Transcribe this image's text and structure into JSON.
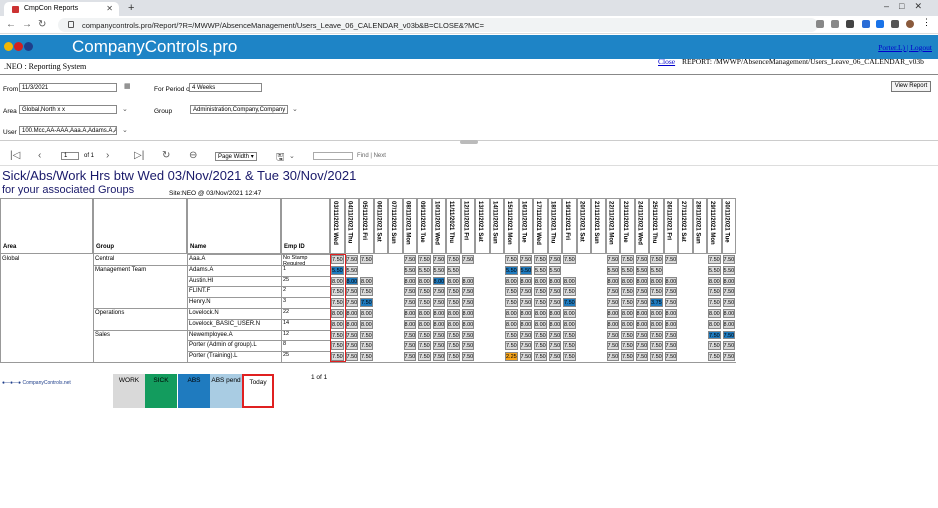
{
  "browser": {
    "tab_title": "CmpCon Reports",
    "url": "companycontrols.pro/Report/?R=/MWWP/AbsenceManagement/Users_Leave_06_CALENDAR_v03b&B=CLOSE&?MC="
  },
  "header": {
    "brand": "CompanyControls.pro",
    "subtitle": ".NEO : Reporting System",
    "user_link": "Porter.L)",
    "logout_link": "Logout",
    "close_link": "Close",
    "report_label": "REPORT: /MWWP/AbsenceManagement/Users_Leave_06_CALENDAR_v03b"
  },
  "params": {
    "from_label": "From",
    "from_value": "11/3/2021",
    "period_label": "For Period of",
    "period_value": "4 Weeks",
    "area_label": "Area",
    "area_value": "Global,North x x",
    "group_label": "Group",
    "group_value": "Administration,Company,Company >",
    "user_label": "User",
    "user_value": "100.Mcc,AA-AAA,Aaa.A,Adams.A,Au",
    "view_report": "View Report"
  },
  "toolbar": {
    "page": "1",
    "of": "of 1",
    "zoom": "Page Width",
    "find": "Find",
    "next": "Next"
  },
  "report": {
    "title": "Sick/Abs/Work Hrs btw Wed 03/Nov/2021 & Tue 30/Nov/2021",
    "subtitle": "for your associated Groups",
    "site": "Site:NEO @ 03/Nov/2021 12:47",
    "col_area": "Area",
    "col_group": "Group",
    "col_name": "Name",
    "col_empid": "Emp ID",
    "dates": [
      "03/11/2021 Wed",
      "04/11/2021 Thu",
      "05/11/2021 Fri",
      "06/11/2021 Sat",
      "07/11/2021 Sun",
      "08/11/2021 Mon",
      "09/11/2021 Tue",
      "10/11/2021 Wed",
      "11/11/2021 Thu",
      "12/11/2021 Fri",
      "13/11/2021 Sat",
      "14/11/2021 Sun",
      "15/11/2021 Mon",
      "16/11/2021 Tue",
      "17/11/2021 Wed",
      "18/11/2021 Thu",
      "19/11/2021 Fri",
      "20/11/2021 Sat",
      "21/11/2021 Sun",
      "22/11/2021 Mon",
      "23/11/2021 Tue",
      "24/11/2021 Wed",
      "25/11/2021 Thu",
      "26/11/2021 Fri",
      "27/11/2021 Sat",
      "28/11/2021 Sun",
      "29/11/2021 Mon",
      "30/11/2021 Tue"
    ],
    "areas": [
      {
        "label": "Global",
        "row": 0
      }
    ],
    "groups": [
      {
        "label": "Central",
        "row": 0
      },
      {
        "label": "Management Team",
        "row": 1
      },
      {
        "label": "Operations",
        "row": 5
      },
      {
        "label": "Sales",
        "row": 7
      }
    ],
    "rows": [
      {
        "name": "Aaa.A",
        "emp": "No Stamp Required",
        "cells": [
          "7.50",
          "7.50",
          "7.50",
          "",
          "",
          "7.50",
          "7.50",
          "7.50",
          "7.50",
          "7.50",
          "",
          "",
          "7.50",
          "7.50",
          "7.50",
          "7.50",
          "7.50",
          "",
          "",
          "7.50",
          "7.50",
          "7.50",
          "7.50",
          "7.50",
          "",
          "",
          "7.50",
          "7.50"
        ],
        "types": [
          "w",
          "w",
          "w",
          "",
          "",
          "w",
          "w",
          "w",
          "w",
          "w",
          "",
          "",
          "w",
          "w",
          "w",
          "w",
          "w",
          "",
          "",
          "w",
          "w",
          "w",
          "w",
          "w",
          "",
          "",
          "w",
          "w"
        ]
      },
      {
        "name": "Adams.A",
        "emp": "1",
        "cells": [
          "5.50",
          "5.50",
          "",
          "",
          "",
          "5.50",
          "5.50",
          "5.50",
          "5.50",
          "",
          "",
          "",
          "5.50",
          "5.50",
          "5.50",
          "5.50",
          "",
          "",
          "",
          "5.50",
          "5.50",
          "5.50",
          "5.50",
          "",
          "",
          "",
          "5.50",
          "5.50"
        ],
        "types": [
          "a",
          "w",
          "",
          "",
          "",
          "w",
          "w",
          "w",
          "w",
          "",
          "",
          "",
          "a",
          "a",
          "w",
          "w",
          "",
          "",
          "",
          "w",
          "w",
          "w",
          "w",
          "",
          "",
          "",
          "w",
          "w"
        ]
      },
      {
        "name": "Austin.HI",
        "emp": "25",
        "cells": [
          "8.00",
          "8.00",
          "8.00",
          "",
          "",
          "8.00",
          "8.00",
          "8.00",
          "8.00",
          "8.00",
          "",
          "",
          "8.00",
          "8.00",
          "8.00",
          "8.00",
          "8.00",
          "",
          "",
          "8.00",
          "8.00",
          "8.00",
          "8.00",
          "8.00",
          "",
          "",
          "8.00",
          "8.00"
        ],
        "types": [
          "w",
          "a",
          "w",
          "",
          "",
          "w",
          "w",
          "a",
          "w",
          "w",
          "",
          "",
          "w",
          "w",
          "w",
          "w",
          "w",
          "",
          "",
          "w",
          "w",
          "w",
          "w",
          "w",
          "",
          "",
          "w",
          "w"
        ]
      },
      {
        "name": "FLINT.F",
        "emp": "2",
        "cells": [
          "7.50",
          "7.50",
          "7.50",
          "",
          "",
          "7.50",
          "7.50",
          "7.50",
          "7.50",
          "7.50",
          "",
          "",
          "7.50",
          "7.50",
          "7.50",
          "7.50",
          "7.50",
          "",
          "",
          "7.50",
          "7.50",
          "7.50",
          "7.50",
          "7.50",
          "",
          "",
          "7.50",
          "7.50"
        ],
        "types": [
          "w",
          "w",
          "w",
          "",
          "",
          "w",
          "w",
          "w",
          "w",
          "w",
          "",
          "",
          "w",
          "w",
          "w",
          "w",
          "w",
          "",
          "",
          "w",
          "w",
          "w",
          "w",
          "w",
          "",
          "",
          "w",
          "w"
        ]
      },
      {
        "name": "Henry.N",
        "emp": "3",
        "cells": [
          "7.50",
          "7.50",
          "7.50",
          "",
          "",
          "7.50",
          "7.50",
          "7.50",
          "7.50",
          "7.50",
          "",
          "",
          "7.50",
          "7.50",
          "7.50",
          "7.50",
          "7.50",
          "",
          "",
          "7.50",
          "7.50",
          "7.50",
          "3.75",
          "7.50",
          "",
          "",
          "7.50",
          "7.50"
        ],
        "types": [
          "w",
          "w",
          "a",
          "",
          "",
          "w",
          "w",
          "w",
          "w",
          "w",
          "",
          "",
          "w",
          "w",
          "w",
          "w",
          "a",
          "",
          "",
          "w",
          "w",
          "w",
          "a",
          "w",
          "",
          "",
          "w",
          "w"
        ]
      },
      {
        "name": "Lovelock.N",
        "emp": "22",
        "cells": [
          "8.00",
          "8.00",
          "8.00",
          "",
          "",
          "8.00",
          "8.00",
          "8.00",
          "8.00",
          "8.00",
          "",
          "",
          "8.00",
          "8.00",
          "8.00",
          "8.00",
          "8.00",
          "",
          "",
          "8.00",
          "8.00",
          "8.00",
          "8.00",
          "8.00",
          "",
          "",
          "8.00",
          "8.00"
        ],
        "types": [
          "w",
          "w",
          "w",
          "",
          "",
          "w",
          "w",
          "w",
          "w",
          "w",
          "",
          "",
          "w",
          "w",
          "w",
          "w",
          "w",
          "",
          "",
          "w",
          "w",
          "w",
          "w",
          "w",
          "",
          "",
          "w",
          "w"
        ]
      },
      {
        "name": "Lovelock_BASIC_USER.N",
        "emp": "14",
        "cells": [
          "8.00",
          "8.00",
          "8.00",
          "",
          "",
          "8.00",
          "8.00",
          "8.00",
          "8.00",
          "8.00",
          "",
          "",
          "8.00",
          "8.00",
          "8.00",
          "8.00",
          "8.00",
          "",
          "",
          "8.00",
          "8.00",
          "8.00",
          "8.00",
          "8.00",
          "",
          "",
          "8.00",
          "8.00"
        ],
        "types": [
          "w",
          "w",
          "w",
          "",
          "",
          "w",
          "w",
          "w",
          "w",
          "w",
          "",
          "",
          "w",
          "w",
          "w",
          "w",
          "w",
          "",
          "",
          "w",
          "w",
          "w",
          "w",
          "w",
          "",
          "",
          "w",
          "w"
        ]
      },
      {
        "name": "Newemployee.A",
        "emp": "12",
        "cells": [
          "7.50",
          "7.50",
          "7.50",
          "",
          "",
          "7.50",
          "7.50",
          "7.50",
          "7.50",
          "7.50",
          "",
          "",
          "7.50",
          "7.50",
          "7.50",
          "7.50",
          "7.50",
          "",
          "",
          "7.50",
          "7.50",
          "7.50",
          "7.50",
          "7.50",
          "",
          "",
          "7.50",
          "7.50"
        ],
        "types": [
          "w",
          "w",
          "w",
          "",
          "",
          "w",
          "w",
          "w",
          "w",
          "w",
          "",
          "",
          "w",
          "w",
          "w",
          "w",
          "w",
          "",
          "",
          "w",
          "w",
          "w",
          "w",
          "w",
          "",
          "",
          "a",
          "a"
        ]
      },
      {
        "name": "Porter (Admin of group).L",
        "emp": "8",
        "cells": [
          "7.50",
          "7.50",
          "7.50",
          "",
          "",
          "7.50",
          "7.50",
          "7.50",
          "7.50",
          "7.50",
          "",
          "",
          "7.50",
          "7.50",
          "7.50",
          "7.50",
          "7.50",
          "",
          "",
          "7.50",
          "7.50",
          "7.50",
          "7.50",
          "7.50",
          "",
          "",
          "7.50",
          "7.50"
        ],
        "types": [
          "w",
          "w",
          "w",
          "",
          "",
          "w",
          "w",
          "w",
          "w",
          "w",
          "",
          "",
          "w",
          "w",
          "w",
          "w",
          "w",
          "",
          "",
          "w",
          "w",
          "w",
          "w",
          "w",
          "",
          "",
          "w",
          "w"
        ]
      },
      {
        "name": "Porter (Training).L",
        "emp": "25",
        "cells": [
          "7.50",
          "7.50",
          "7.50",
          "",
          "",
          "7.50",
          "7.50",
          "7.50",
          "7.50",
          "7.50",
          "",
          "",
          "2.25",
          "7.50",
          "7.50",
          "7.50",
          "7.50",
          "",
          "",
          "7.50",
          "7.50",
          "7.50",
          "7.50",
          "7.50",
          "",
          "",
          "7.50",
          "7.50"
        ],
        "types": [
          "w",
          "w",
          "w",
          "",
          "",
          "w",
          "w",
          "w",
          "w",
          "w",
          "",
          "",
          "p",
          "w",
          "w",
          "w",
          "w",
          "",
          "",
          "w",
          "w",
          "w",
          "w",
          "w",
          "",
          "",
          "w",
          "w"
        ]
      }
    ],
    "page_count": "1 of 1"
  },
  "legend": {
    "logo": "CompanyControls.net",
    "items": [
      {
        "label": "WORK",
        "color": "#d9d9d9"
      },
      {
        "label": "SICK",
        "color": "#139c5e"
      },
      {
        "label": "ABS",
        "color": "#1f7bbf"
      },
      {
        "label": "ABS pend",
        "color": "#a9cce3"
      },
      {
        "label": "Today",
        "color": "#ffffff"
      }
    ]
  },
  "colors": {
    "brand": "#1e84c6",
    "work": "#d9d9d9",
    "abs": "#1f7bbf",
    "sick": "#139c5e",
    "pending": "#f5a31a",
    "today": "#e02020"
  }
}
